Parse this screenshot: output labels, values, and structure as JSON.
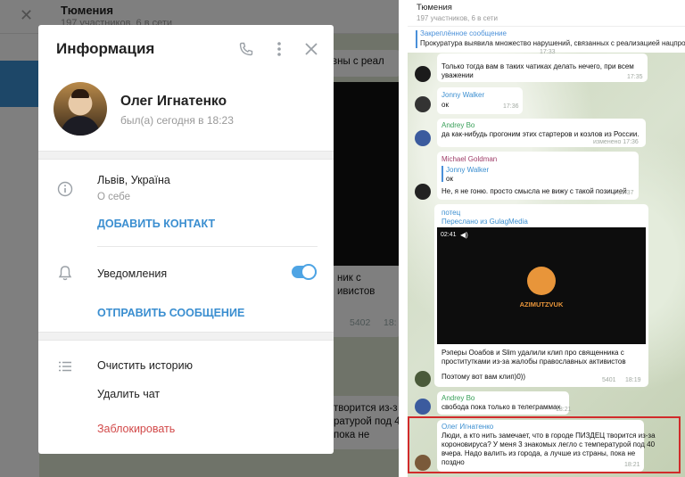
{
  "left": {
    "background": {
      "title": "Тюмения",
      "subtitle": "197 участников, 6 в сети",
      "frag1": "вны с реал",
      "frag2": "ник с",
      "frag3": "ивистов",
      "views": "5402",
      "time1": "18:",
      "frag4": "творится из-з",
      "frag5": "ратурой под 4",
      "frag6": "пока не"
    },
    "modal": {
      "title": "Информация",
      "name": "Олег Игнатенко",
      "last_seen": "был(а) сегодня в 18:23",
      "location": "Львів, Україна",
      "about_label": "О себе",
      "add_contact": "ДОБАВИТЬ КОНТАКТ",
      "notifications": "Уведомления",
      "notifications_on": true,
      "send_message": "ОТПРАВИТЬ СООБЩЕНИЕ",
      "clear_history": "Очистить историю",
      "delete_chat": "Удалить чат",
      "block": "Заблокировать"
    }
  },
  "right": {
    "header": {
      "title": "Тюмения",
      "subtitle": "197 участников, 6 в сети"
    },
    "pinned": {
      "title": "Закреплённое сообщение",
      "text": "Прокуратура выявила множество нарушений, связанных с реализацией нацпро"
    },
    "messages": [
      {
        "line1": "Только тогда вам в таких чатиках делать нечего, при всем",
        "line2": "уважении",
        "time": "17:35",
        "top_time": "17:33"
      },
      {
        "sender": "Jonny Walker",
        "text": "ок",
        "time": "17:36"
      },
      {
        "sender": "Andrey Bo",
        "line1": "да как-нибудь прогоним этих стартеров и козлов из России.",
        "time": "изменено 17:36"
      },
      {
        "sender": "Michael Goldman",
        "quote_sender": "Jonny Walker",
        "quote_text": "ок",
        "text": "Не, я не гоню. просто смысла не вижу с такой позицией",
        "time": "17:37"
      },
      {
        "sender": "потец",
        "forwarded": "Переслано из GulagMedia",
        "video_time": "02:41",
        "video_brand": "AZIMUTZVUK",
        "line1": "Рэперы Ооабов и Slim удалили клип про священника с",
        "line2": "проститутками из-за жалобы православных активистов",
        "line3": "Поэтому вот вам клип)0))",
        "views": "5401",
        "time": "18:19"
      },
      {
        "sender": "Andrey Bo",
        "text": "свобода пока только в телеграммах",
        "time": "18:21"
      },
      {
        "sender": "Олег Игнатенко",
        "line1": "Люди, а кто нить замечает, что в городе ПИЗДЕЦ творится из-за",
        "line2": "короновируса? У меня 3 знакомых легло с температурой под 40",
        "line3": "вчера. Надо валить из города, а лучше из страны, пока не",
        "line4": "поздно",
        "time": "18:21"
      }
    ]
  },
  "colors": {
    "accent": "#3a8ed0",
    "danger": "#d24949",
    "highlight": "#d12b2b"
  }
}
